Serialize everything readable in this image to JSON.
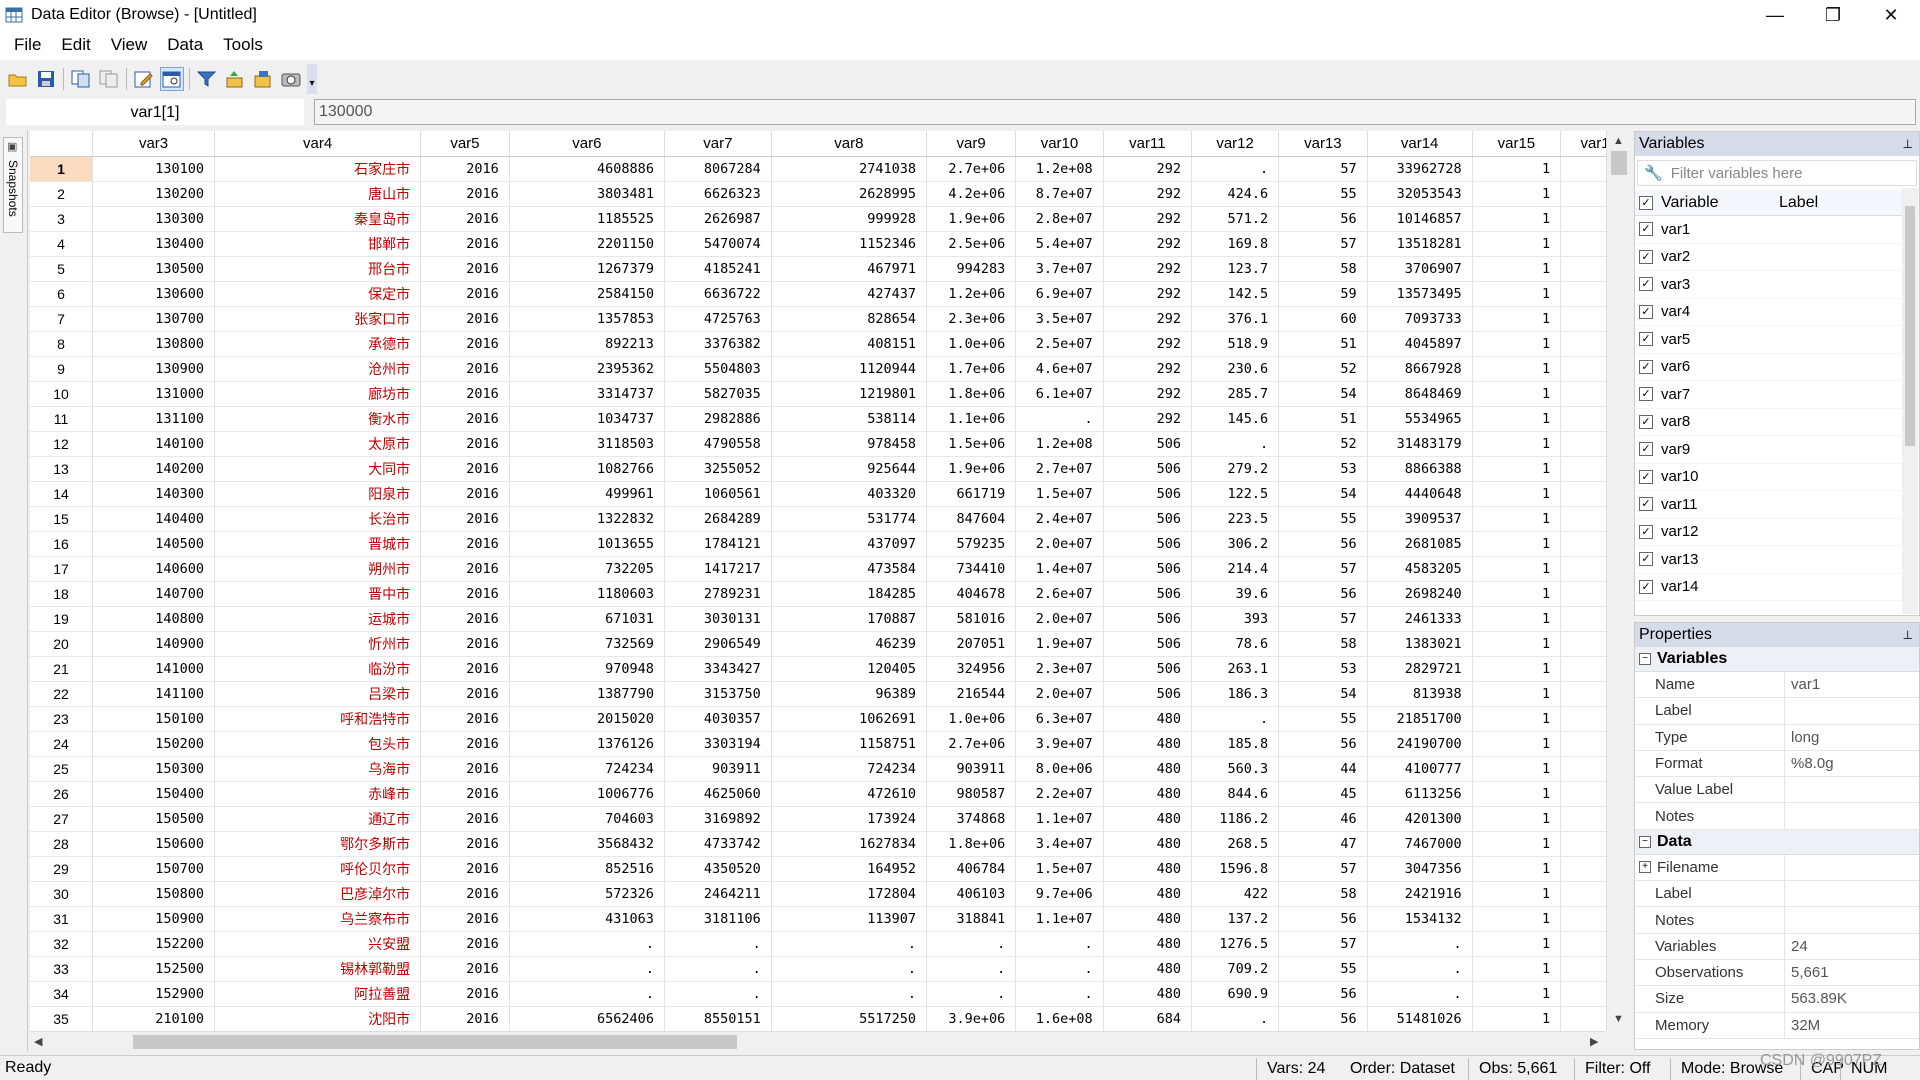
{
  "window": {
    "title": "Data Editor (Browse) - [Untitled]",
    "minimize": "—",
    "restore": "❐",
    "close": "✕"
  },
  "menu": [
    "File",
    "Edit",
    "View",
    "Data",
    "Tools"
  ],
  "toolbar_icons": [
    "open-icon",
    "save-icon",
    "copy-icon",
    "paste-icon",
    "edit-icon",
    "browse-icon",
    "filter-icon",
    "variables-icon",
    "properties-icon",
    "snapshot-icon"
  ],
  "cell": {
    "name": "var1[1]",
    "value": "130000"
  },
  "snapshots": {
    "label": "Snapshots"
  },
  "columns": [
    "var3",
    "var4",
    "var5",
    "var6",
    "var7",
    "var8",
    "var9",
    "var10",
    "var11",
    "var12",
    "var13",
    "var14",
    "var15",
    "var1"
  ],
  "rows": [
    [
      "1",
      "130100",
      "石家庄市",
      "2016",
      "4608886",
      "8067284",
      "2741038",
      "2.7e+06",
      "1.2e+08",
      "292",
      ".",
      "57",
      "33962728",
      "1"
    ],
    [
      "2",
      "130200",
      "唐山市",
      "2016",
      "3803481",
      "6626323",
      "2628995",
      "4.2e+06",
      "8.7e+07",
      "292",
      "424.6",
      "55",
      "32053543",
      "1"
    ],
    [
      "3",
      "130300",
      "秦皇岛市",
      "2016",
      "1185525",
      "2626987",
      "999928",
      "1.9e+06",
      "2.8e+07",
      "292",
      "571.2",
      "56",
      "10146857",
      "1"
    ],
    [
      "4",
      "130400",
      "邯郸市",
      "2016",
      "2201150",
      "5470074",
      "1152346",
      "2.5e+06",
      "5.4e+07",
      "292",
      "169.8",
      "57",
      "13518281",
      "1"
    ],
    [
      "5",
      "130500",
      "邢台市",
      "2016",
      "1267379",
      "4185241",
      "467971",
      "994283",
      "3.7e+07",
      "292",
      "123.7",
      "58",
      "3706907",
      "1"
    ],
    [
      "6",
      "130600",
      "保定市",
      "2016",
      "2584150",
      "6636722",
      "427437",
      "1.2e+06",
      "6.9e+07",
      "292",
      "142.5",
      "59",
      "13573495",
      "1"
    ],
    [
      "7",
      "130700",
      "张家口市",
      "2016",
      "1357853",
      "4725763",
      "828654",
      "2.3e+06",
      "3.5e+07",
      "292",
      "376.1",
      "60",
      "7093733",
      "1"
    ],
    [
      "8",
      "130800",
      "承德市",
      "2016",
      "892213",
      "3376382",
      "408151",
      "1.0e+06",
      "2.5e+07",
      "292",
      "518.9",
      "51",
      "4045897",
      "1"
    ],
    [
      "9",
      "130900",
      "沧州市",
      "2016",
      "2395362",
      "5504803",
      "1120944",
      "1.7e+06",
      "4.6e+07",
      "292",
      "230.6",
      "52",
      "8667928",
      "1"
    ],
    [
      "10",
      "131000",
      "廊坊市",
      "2016",
      "3314737",
      "5827035",
      "1219801",
      "1.8e+06",
      "6.1e+07",
      "292",
      "285.7",
      "54",
      "8648469",
      "1"
    ],
    [
      "11",
      "131100",
      "衡水市",
      "2016",
      "1034737",
      "2982886",
      "538114",
      "1.1e+06",
      ".",
      "292",
      "145.6",
      "51",
      "5534965",
      "1"
    ],
    [
      "12",
      "140100",
      "太原市",
      "2016",
      "3118503",
      "4790558",
      "978458",
      "1.5e+06",
      "1.2e+08",
      "506",
      ".",
      "52",
      "31483179",
      "1"
    ],
    [
      "13",
      "140200",
      "大同市",
      "2016",
      "1082766",
      "3255052",
      "925644",
      "1.9e+06",
      "2.7e+07",
      "506",
      "279.2",
      "53",
      "8866388",
      "1"
    ],
    [
      "14",
      "140300",
      "阳泉市",
      "2016",
      "499961",
      "1060561",
      "403320",
      "661719",
      "1.5e+07",
      "506",
      "122.5",
      "54",
      "4440648",
      "1"
    ],
    [
      "15",
      "140400",
      "长治市",
      "2016",
      "1322832",
      "2684289",
      "531774",
      "847604",
      "2.4e+07",
      "506",
      "223.5",
      "55",
      "3909537",
      "1"
    ],
    [
      "16",
      "140500",
      "晋城市",
      "2016",
      "1013655",
      "1784121",
      "437097",
      "579235",
      "2.0e+07",
      "506",
      "306.2",
      "56",
      "2681085",
      "1"
    ],
    [
      "17",
      "140600",
      "朔州市",
      "2016",
      "732205",
      "1417217",
      "473584",
      "734410",
      "1.4e+07",
      "506",
      "214.4",
      "57",
      "4583205",
      "1"
    ],
    [
      "18",
      "140700",
      "晋中市",
      "2016",
      "1180603",
      "2789231",
      "184285",
      "404678",
      "2.6e+07",
      "506",
      "39.6",
      "56",
      "2698240",
      "1"
    ],
    [
      "19",
      "140800",
      "运城市",
      "2016",
      "671031",
      "3030131",
      "170887",
      "581016",
      "2.0e+07",
      "506",
      "393",
      "57",
      "2461333",
      "1"
    ],
    [
      "20",
      "140900",
      "忻州市",
      "2016",
      "732569",
      "2906549",
      "46239",
      "207051",
      "1.9e+07",
      "506",
      "78.6",
      "58",
      "1383021",
      "1"
    ],
    [
      "21",
      "141000",
      "临汾市",
      "2016",
      "970948",
      "3343427",
      "120405",
      "324956",
      "2.3e+07",
      "506",
      "263.1",
      "53",
      "2829721",
      "1"
    ],
    [
      "22",
      "141100",
      "吕梁市",
      "2016",
      "1387790",
      "3153750",
      "96389",
      "216544",
      "2.0e+07",
      "506",
      "186.3",
      "54",
      "813938",
      "1"
    ],
    [
      "23",
      "150100",
      "呼和浩特市",
      "2016",
      "2015020",
      "4030357",
      "1062691",
      "1.0e+06",
      "6.3e+07",
      "480",
      ".",
      "55",
      "21851700",
      "1"
    ],
    [
      "24",
      "150200",
      "包头市",
      "2016",
      "1376126",
      "3303194",
      "1158751",
      "2.7e+06",
      "3.9e+07",
      "480",
      "185.8",
      "56",
      "24190700",
      "1"
    ],
    [
      "25",
      "150300",
      "乌海市",
      "2016",
      "724234",
      "903911",
      "724234",
      "903911",
      "8.0e+06",
      "480",
      "560.3",
      "44",
      "4100777",
      "1"
    ],
    [
      "26",
      "150400",
      "赤峰市",
      "2016",
      "1006776",
      "4625060",
      "472610",
      "980587",
      "2.2e+07",
      "480",
      "844.6",
      "45",
      "6113256",
      "1"
    ],
    [
      "27",
      "150500",
      "通辽市",
      "2016",
      "704603",
      "3169892",
      "173924",
      "374868",
      "1.1e+07",
      "480",
      "1186.2",
      "46",
      "4201300",
      "1"
    ],
    [
      "28",
      "150600",
      "鄂尔多斯市",
      "2016",
      "3568432",
      "4733742",
      "1627834",
      "1.8e+06",
      "3.4e+07",
      "480",
      "268.5",
      "47",
      "7467000",
      "1"
    ],
    [
      "29",
      "150700",
      "呼伦贝尔市",
      "2016",
      "852516",
      "4350520",
      "164952",
      "406784",
      "1.5e+07",
      "480",
      "1596.8",
      "57",
      "3047356",
      "1"
    ],
    [
      "30",
      "150800",
      "巴彦淖尔市",
      "2016",
      "572326",
      "2464211",
      "172804",
      "406103",
      "9.7e+06",
      "480",
      "422",
      "58",
      "2421916",
      "1"
    ],
    [
      "31",
      "150900",
      "乌兰察布市",
      "2016",
      "431063",
      "3181106",
      "113907",
      "318841",
      "1.1e+07",
      "480",
      "137.2",
      "56",
      "1534132",
      "1"
    ],
    [
      "32",
      "152200",
      "兴安盟",
      "2016",
      ".",
      ".",
      ".",
      ".",
      ".",
      "480",
      "1276.5",
      "57",
      ".",
      "1"
    ],
    [
      "33",
      "152500",
      "锡林郭勒盟",
      "2016",
      ".",
      ".",
      ".",
      ".",
      ".",
      "480",
      "709.2",
      "55",
      ".",
      "1"
    ],
    [
      "34",
      "152900",
      "阿拉善盟",
      "2016",
      ".",
      ".",
      ".",
      ".",
      ".",
      "480",
      "690.9",
      "56",
      ".",
      "1"
    ],
    [
      "35",
      "210100",
      "沈阳市",
      "2016",
      "6562406",
      "8550151",
      "5517250",
      "3.9e+06",
      "1.6e+08",
      "684",
      ".",
      "56",
      "51481026",
      "1"
    ]
  ],
  "variables_panel": {
    "title": "Variables",
    "pin": "📌",
    "filter_placeholder": "Filter variables here",
    "col_variable": "Variable",
    "col_label": "Label",
    "items": [
      "var1",
      "var2",
      "var3",
      "var4",
      "var5",
      "var6",
      "var7",
      "var8",
      "var9",
      "var10",
      "var11",
      "var12",
      "var13",
      "var14"
    ]
  },
  "properties_panel": {
    "title": "Properties",
    "pin": "📌",
    "sections": [
      {
        "name": "Variables",
        "toggle": "−",
        "rows": [
          [
            "Name",
            "var1"
          ],
          [
            "Label",
            ""
          ],
          [
            "Type",
            "long"
          ],
          [
            "Format",
            "%8.0g"
          ],
          [
            "Value Label",
            ""
          ],
          [
            "Notes",
            ""
          ]
        ]
      },
      {
        "name": "Data",
        "toggle": "−",
        "rows": [
          [
            "Filename",
            ""
          ],
          [
            "Label",
            ""
          ],
          [
            "Notes",
            ""
          ],
          [
            "Variables",
            "24"
          ],
          [
            "Observations",
            "5,661"
          ],
          [
            "Size",
            "563.89K"
          ],
          [
            "Memory",
            "32M"
          ]
        ]
      }
    ]
  },
  "status": {
    "ready": "Ready",
    "vars": "Vars: 24",
    "order": "Order: Dataset",
    "obs": "Obs: 5,661",
    "filter": "Filter: Off",
    "mode": "Mode: Browse",
    "cap": "CAP",
    "num": "NUM"
  },
  "watermark": "CSDN @9907PZ"
}
